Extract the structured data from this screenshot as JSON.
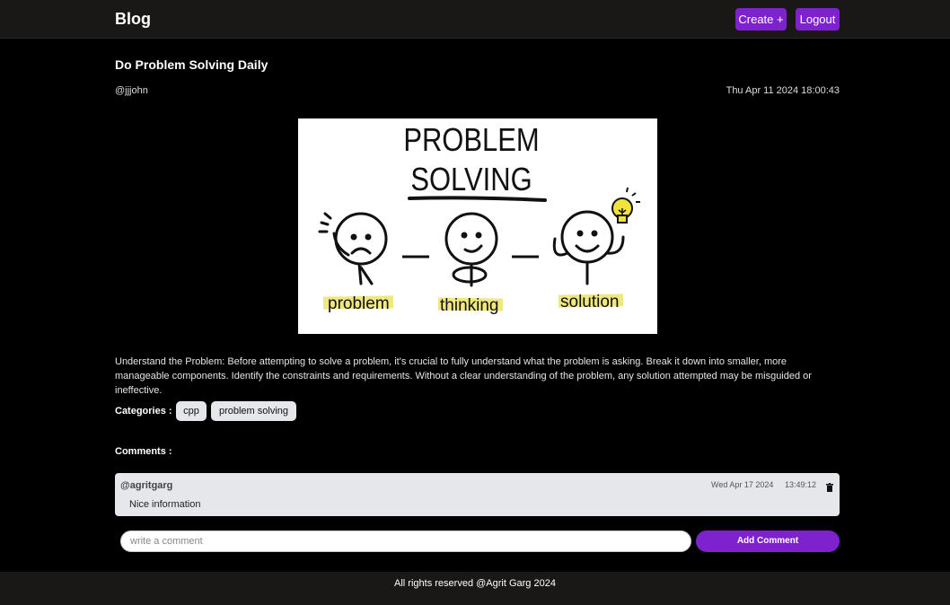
{
  "navbar": {
    "brand": "Blog",
    "create_label": "Create +",
    "logout_label": "Logout"
  },
  "post": {
    "title": "Do Problem Solving Daily",
    "author": "@jjjohn",
    "date": "Thu Apr 11 2024  18:00:43",
    "image": {
      "heading_line1": "PROBLEM",
      "heading_line2": "SOLVING",
      "label_problem": "problem",
      "label_thinking": "thinking",
      "label_solution": "solution"
    },
    "body": "Understand the Problem: Before attempting to solve a problem, it's crucial to fully understand what the problem is asking. Break it down into smaller, more manageable components. Identify the constraints and requirements. Without a clear understanding of the problem, any solution attempted may be misguided or ineffective."
  },
  "categories": {
    "label": "Categories :",
    "items": [
      "cpp",
      "problem solving"
    ]
  },
  "comments": {
    "label": "Comments :",
    "items": [
      {
        "user": "@agritgarg",
        "date": "Wed Apr 17 2024",
        "time": "13:49:12",
        "text": "Nice information"
      }
    ],
    "input_placeholder": "write a comment",
    "add_label": "Add Comment"
  },
  "footer": {
    "text": "All rights reserved @Agrit Garg 2024"
  },
  "colors": {
    "accent": "#7e22ce",
    "highlight": "#ece36a",
    "bulb": "#f2e33a"
  }
}
